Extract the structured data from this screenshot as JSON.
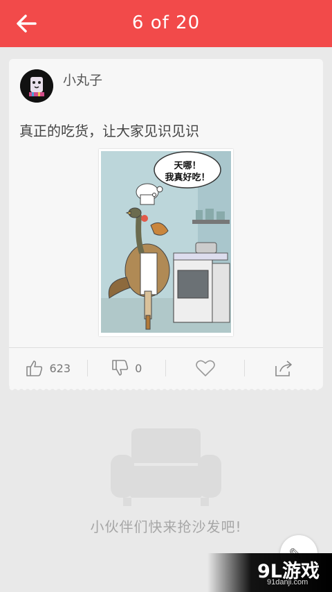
{
  "header": {
    "page_indicator": "6 of 20"
  },
  "post": {
    "username": "小丸子",
    "text": "真正的吃货，让大家见识见识",
    "image_bubble_text": [
      "天哪！",
      "我真好吃！"
    ]
  },
  "actions": {
    "like_count": "623",
    "dislike_count": "0"
  },
  "empty_state": {
    "message": "小伙伴们快来抢沙发吧!"
  },
  "watermark": {
    "logo": "9L游戏",
    "url": "91danji.com"
  },
  "colors": {
    "accent": "#f24a4a",
    "background": "#e9e9e9",
    "card": "#f7f7f7"
  },
  "icons": [
    "back-arrow-icon",
    "thumbs-up-icon",
    "thumbs-down-icon",
    "heart-icon",
    "share-icon",
    "sofa-icon"
  ]
}
